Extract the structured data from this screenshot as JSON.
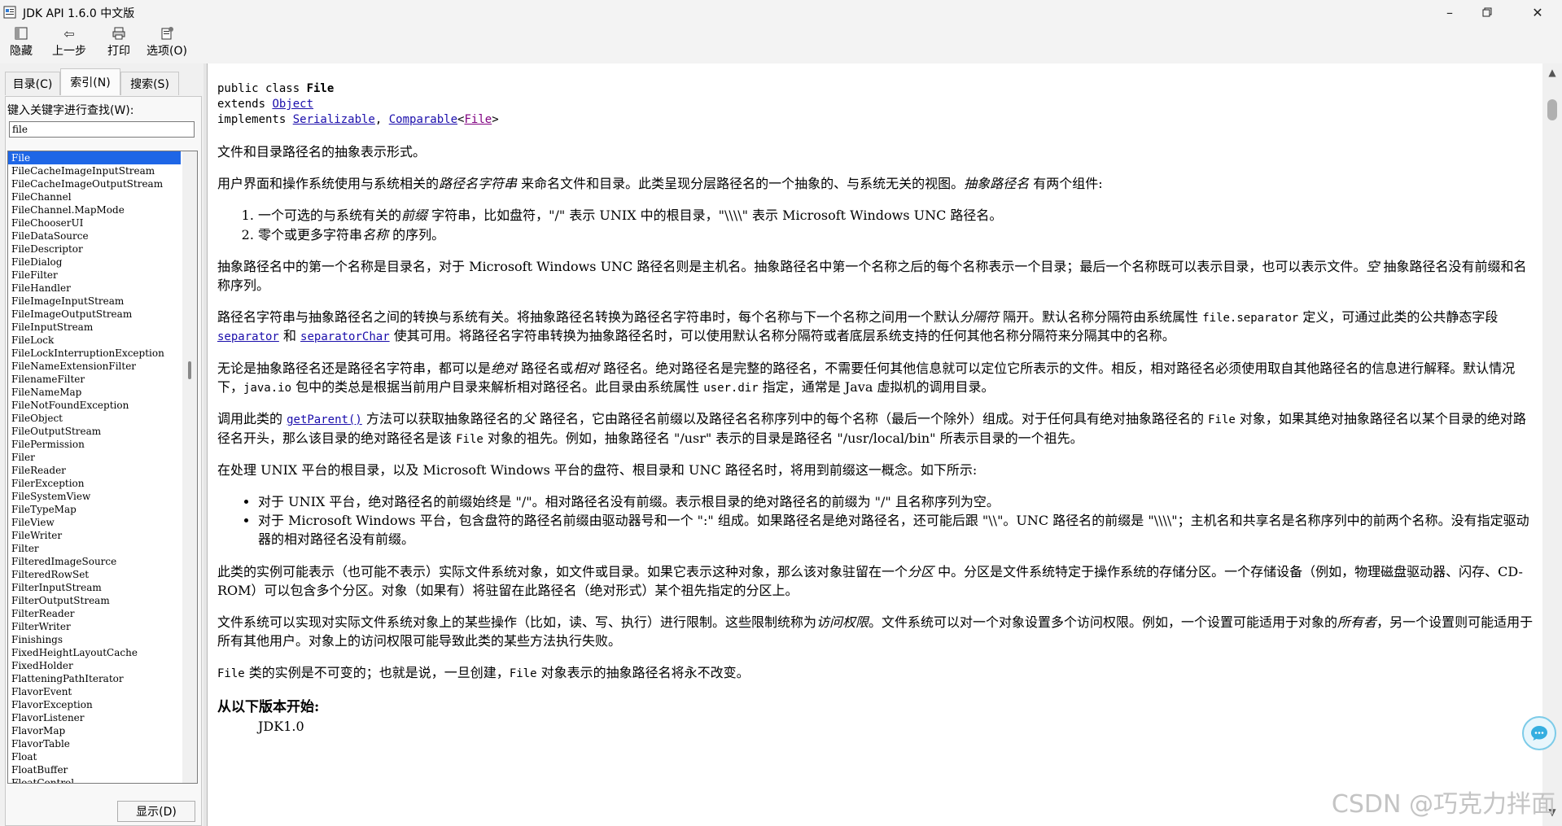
{
  "window": {
    "title": "JDK API 1.6.0 中文版"
  },
  "toolbar": {
    "hide": "隐藏",
    "back": "上一步",
    "print": "打印",
    "options": "选项(O)"
  },
  "tabs": {
    "contents": "目录(C)",
    "index": "索引(N)",
    "search": "搜索(S)"
  },
  "index_panel": {
    "label": "键入关键字进行查找(W):",
    "input_value": "file",
    "items": [
      "File",
      "FileCacheImageInputStream",
      "FileCacheImageOutputStream",
      "FileChannel",
      "FileChannel.MapMode",
      "FileChooserUI",
      "FileDataSource",
      "FileDescriptor",
      "FileDialog",
      "FileFilter",
      "FileHandler",
      "FileImageInputStream",
      "FileImageOutputStream",
      "FileInputStream",
      "FileLock",
      "FileLockInterruptionException",
      "FileNameExtensionFilter",
      "FilenameFilter",
      "FileNameMap",
      "FileNotFoundException",
      "FileObject",
      "FileOutputStream",
      "FilePermission",
      "Filer",
      "FileReader",
      "FilerException",
      "FileSystemView",
      "FileTypeMap",
      "FileView",
      "FileWriter",
      "Filter",
      "FilteredImageSource",
      "FilteredRowSet",
      "FilterInputStream",
      "FilterOutputStream",
      "FilterReader",
      "FilterWriter",
      "Finishings",
      "FixedHeightLayoutCache",
      "FixedHolder",
      "FlatteningPathIterator",
      "FlavorEvent",
      "FlavorException",
      "FlavorListener",
      "FlavorMap",
      "FlavorTable",
      "Float",
      "FloatBuffer",
      "FloatControl"
    ],
    "selected_index": 0,
    "display_button": "显示(D)"
  },
  "doc": {
    "decl": {
      "line1_prefix": "public class ",
      "class_name": "File",
      "extends_kw": "extends ",
      "superclass": "Object",
      "implements_kw": "implements ",
      "iface1": "Serializable",
      "sep": ", ",
      "iface2": "Comparable",
      "generic_open": "<",
      "generic_type": "File",
      "generic_close": ">"
    },
    "p1": "文件和目录路径名的抽象表示形式。",
    "p2": {
      "a": "用户界面和操作系统使用与系统相关的",
      "a_em": "路径名字符串",
      "b": " 来命名文件和目录。此类呈现分层路径名的一个抽象的、与系统无关的视图。",
      "b_em": "抽象路径名",
      "c": " 有两个组件:"
    },
    "ol1": {
      "a": "一个可选的与系统有关的",
      "em": "前缀",
      "b": " 字符串，比如盘符，\"/\" 表示 UNIX 中的根目录，\"\\\\\\\\\" 表示 Microsoft Windows UNC 路径名。"
    },
    "ol2": {
      "a": "零个或更多字符串",
      "em": "名称",
      "b": " 的序列。"
    },
    "p3": {
      "a": "抽象路径名中的第一个名称是目录名，对于 Microsoft Windows UNC 路径名则是主机名。抽象路径名中第一个名称之后的每个名称表示一个目录；最后一个名称既可以表示目录，也可以表示文件。",
      "em": "空",
      "b": " 抽象路径名没有前缀和名称序列。"
    },
    "p4": {
      "a": "路径名字符串与抽象路径名之间的转换与系统有关。将抽象路径名转换为路径名字符串时，每个名称与下一个名称之间用一个默认",
      "em": "分隔符",
      "b": " 隔开。默认名称分隔符由系统属性 ",
      "code": "file.separator",
      "c": " 定义，可通过此类的公共静态字段 ",
      "link1": "separator",
      "d": " 和 ",
      "link2": "separatorChar",
      "e": " 使其可用。将路径名字符串转换为抽象路径名时，可以使用默认名称分隔符或者底层系统支持的任何其他名称分隔符来分隔其中的名称。"
    },
    "p5": {
      "a": "无论是抽象路径名还是路径名字符串，都可以是",
      "em1": "绝对",
      "b": " 路径名或",
      "em2": "相对",
      "c": " 路径名。绝对路径名是完整的路径名，不需要任何其他信息就可以定位它所表示的文件。相反，相对路径名必须使用取自其他路径名的信息进行解释。默认情况下，",
      "code1": "java.io",
      "d": " 包中的类总是根据当前用户目录来解析相对路径名。此目录由系统属性 ",
      "code2": "user.dir",
      "e": " 指定，通常是 Java 虚拟机的调用目录。"
    },
    "p6": {
      "a": "调用此类的 ",
      "link": "getParent()",
      "b": " 方法可以获取抽象路径名的",
      "em": "父",
      "c": " 路径名，它由路径名前缀以及路径名名称序列中的每个名称（最后一个除外）组成。对于任何具有绝对抽象路径名的 ",
      "code1": "File",
      "d": " 对象，如果其绝对抽象路径名以某个目录的绝对路径名开头，那么该目录的绝对路径名是该 ",
      "code2": "File",
      "e": " 对象的祖先。例如，抽象路径名 \"/usr\" 表示的目录是路径名 \"/usr/local/bin\" 所表示目录的一个祖先。"
    },
    "p7": "在处理 UNIX 平台的根目录，以及 Microsoft Windows 平台的盘符、根目录和 UNC 路径名时，将用到前缀这一概念。如下所示:",
    "ul1": "对于 UNIX 平台，绝对路径名的前缀始终是 \"/\"。相对路径名没有前缀。表示根目录的绝对路径名的前缀为 \"/\" 且名称序列为空。",
    "ul2": "对于 Microsoft Windows 平台，包含盘符的路径名前缀由驱动器号和一个 \":\" 组成。如果路径名是绝对路径名，还可能后跟 \"\\\\\"。UNC 路径名的前缀是 \"\\\\\\\\\"；主机名和共享名是名称序列中的前两个名称。没有指定驱动器的相对路径名没有前缀。",
    "p8": {
      "a": "此类的实例可能表示（也可能不表示）实际文件系统对象，如文件或目录。如果它表示这种对象，那么该对象驻留在一个",
      "em": "分区",
      "b": " 中。分区是文件系统特定于操作系统的存储分区。一个存储设备（例如，物理磁盘驱动器、闪存、CD-ROM）可以包含多个分区。对象（如果有）将驻留在此路径名（绝对形式）某个祖先指定的分区上。"
    },
    "p9": {
      "a": "文件系统可以实现对实际文件系统对象上的某些操作（比如，读、写、执行）进行限制。这些限制统称为",
      "em1": "访问权限",
      "b": "。文件系统可以对一个对象设置多个访问权限。例如，一个设置可能适用于对象的",
      "em2": "所有者",
      "c": "，另一个设置则可能适用于所有其他用户。对象上的访问权限可能导致此类的某些方法执行失败。"
    },
    "p10": {
      "code1": "File",
      "a": " 类的实例是不可变的；也就是说，一旦创建，",
      "code2": "File",
      "b": " 对象表示的抽象路径名将永不改变。"
    },
    "since_heading": "从以下版本开始:",
    "since_value": "JDK1.0"
  },
  "watermark": "CSDN @巧克力拌面"
}
